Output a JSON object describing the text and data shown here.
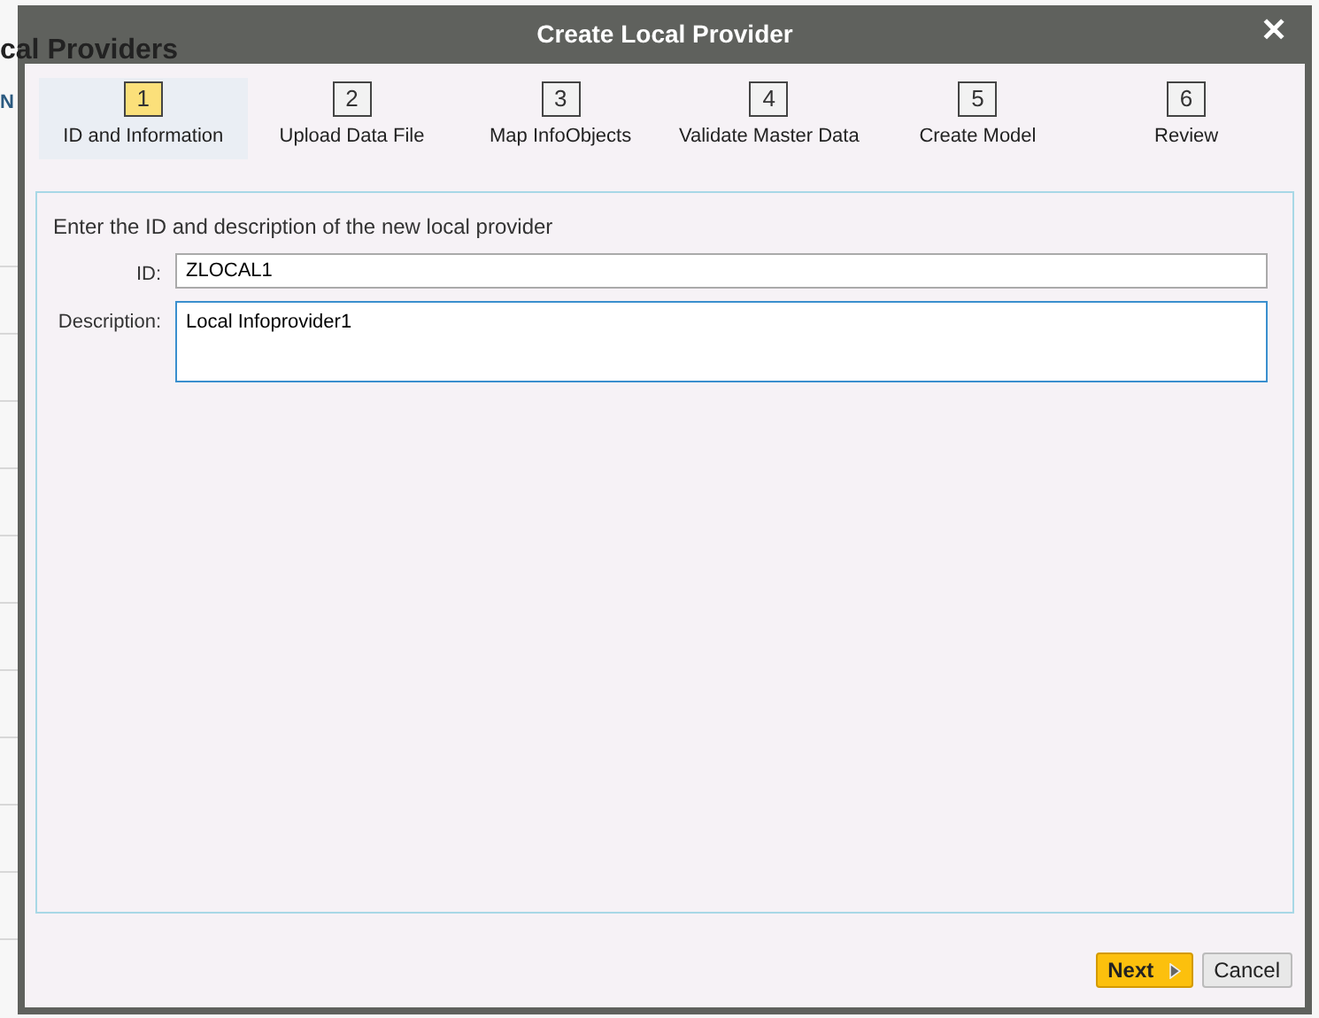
{
  "background_page": {
    "title": "cal Providers",
    "column_1": "N"
  },
  "dialog": {
    "title": "Create Local Provider",
    "close": "✕"
  },
  "steps": [
    {
      "number": "1",
      "label": "ID and Information",
      "selected": true
    },
    {
      "number": "2",
      "label": "Upload Data File",
      "selected": false
    },
    {
      "number": "3",
      "label": "Map InfoObjects",
      "selected": false
    },
    {
      "number": "4",
      "label": "Validate Master Data",
      "selected": false
    },
    {
      "number": "5",
      "label": "Create Model",
      "selected": false
    },
    {
      "number": "6",
      "label": "Review",
      "selected": false
    }
  ],
  "form": {
    "instruction": "Enter the ID and description of the new local provider",
    "fields": [
      {
        "kind": "input",
        "label": "ID:",
        "value": "ZLOCAL1",
        "focused": false
      },
      {
        "kind": "textarea",
        "label": "Description:",
        "value": "Local Infoprovider1",
        "focused": true
      }
    ]
  },
  "buttons": [
    {
      "kind": "primary",
      "label": "Next"
    },
    {
      "kind": "secondary",
      "label": "Cancel"
    }
  ]
}
